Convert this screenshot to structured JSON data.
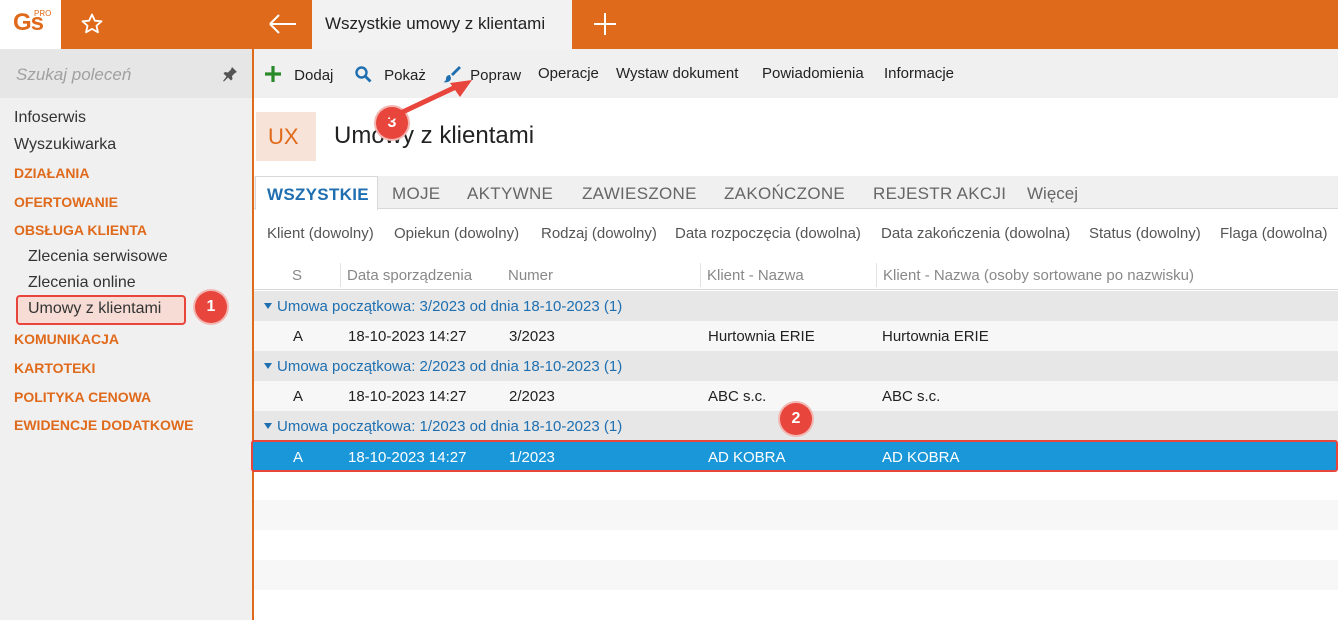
{
  "app": {
    "logo_text": "Gs",
    "logo_sup": "PRO",
    "active_tab": "Wszystkie umowy z klientami"
  },
  "sidebar": {
    "search_placeholder": "Szukaj poleceń",
    "items": [
      {
        "label": "Infoserwis",
        "kind": "item"
      },
      {
        "label": "Wyszukiwarka",
        "kind": "item"
      },
      {
        "label": "DZIAŁANIA",
        "kind": "section"
      },
      {
        "label": "OFERTOWANIE",
        "kind": "section"
      },
      {
        "label": "OBSŁUGA KLIENTA",
        "kind": "section"
      },
      {
        "label": "Zlecenia serwisowe",
        "kind": "sub"
      },
      {
        "label": "Zlecenia online",
        "kind": "sub"
      },
      {
        "label": "Umowy z klientami",
        "kind": "sub",
        "selected": true
      },
      {
        "label": "KOMUNIKACJA",
        "kind": "section"
      },
      {
        "label": "KARTOTEKI",
        "kind": "section"
      },
      {
        "label": "POLITYKA CENOWA",
        "kind": "section"
      },
      {
        "label": "EWIDENCJE DODATKOWE",
        "kind": "section"
      }
    ]
  },
  "toolbar": {
    "add": "Dodaj",
    "show": "Pokaż",
    "edit": "Popraw",
    "operations": "Operacje",
    "issue_document": "Wystaw dokument",
    "notifications": "Powiadomienia",
    "info": "Informacje"
  },
  "header": {
    "badge": "UX",
    "title": "Umowy z klientami"
  },
  "tabs": [
    "WSZYSTKIE",
    "MOJE",
    "AKTYWNE",
    "ZAWIESZONE",
    "ZAKOŃCZONE",
    "REJESTR AKCJI",
    "Więcej"
  ],
  "filters": [
    "Klient (dowolny)",
    "Opiekun (dowolny)",
    "Rodzaj (dowolny)",
    "Data rozpoczęcia (dowolna)",
    "Data zakończenia (dowolna)",
    "Status (dowolny)",
    "Flaga (dowolna)"
  ],
  "grid": {
    "columns": [
      "S",
      "Data sporządzenia",
      "Numer",
      "Klient - Nazwa",
      "Klient - Nazwa (osoby sortowane po nazwisku)"
    ],
    "groups": [
      {
        "label": "Umowa początkowa: 3/2023 od dnia 18-10-2023 (1)",
        "row": [
          "A",
          "18-10-2023 14:27",
          "3/2023",
          "Hurtownia ERIE",
          "Hurtownia ERIE"
        ]
      },
      {
        "label": "Umowa początkowa: 2/2023 od dnia 18-10-2023 (1)",
        "row": [
          "A",
          "18-10-2023 14:27",
          "2/2023",
          "ABC s.c.",
          "ABC s.c."
        ]
      },
      {
        "label": "Umowa początkowa: 1/2023 od dnia 18-10-2023 (1)",
        "row": [
          "A",
          "18-10-2023 14:27",
          "1/2023",
          "AD KOBRA",
          "AD KOBRA"
        ],
        "selected": true
      }
    ]
  },
  "annotations": [
    "1",
    "2",
    "3"
  ],
  "colors": {
    "brand": "#e06a1b",
    "accent_blue": "#1f6fb0",
    "selection": "#1a97d8",
    "annotation_red": "#e8453c"
  },
  "icons": {
    "favorite": "star-icon",
    "back": "arrow-left-icon",
    "new_tab": "plus-icon",
    "pin": "pin-icon",
    "add": "plus-icon",
    "show": "search-icon",
    "edit": "brush-icon"
  }
}
